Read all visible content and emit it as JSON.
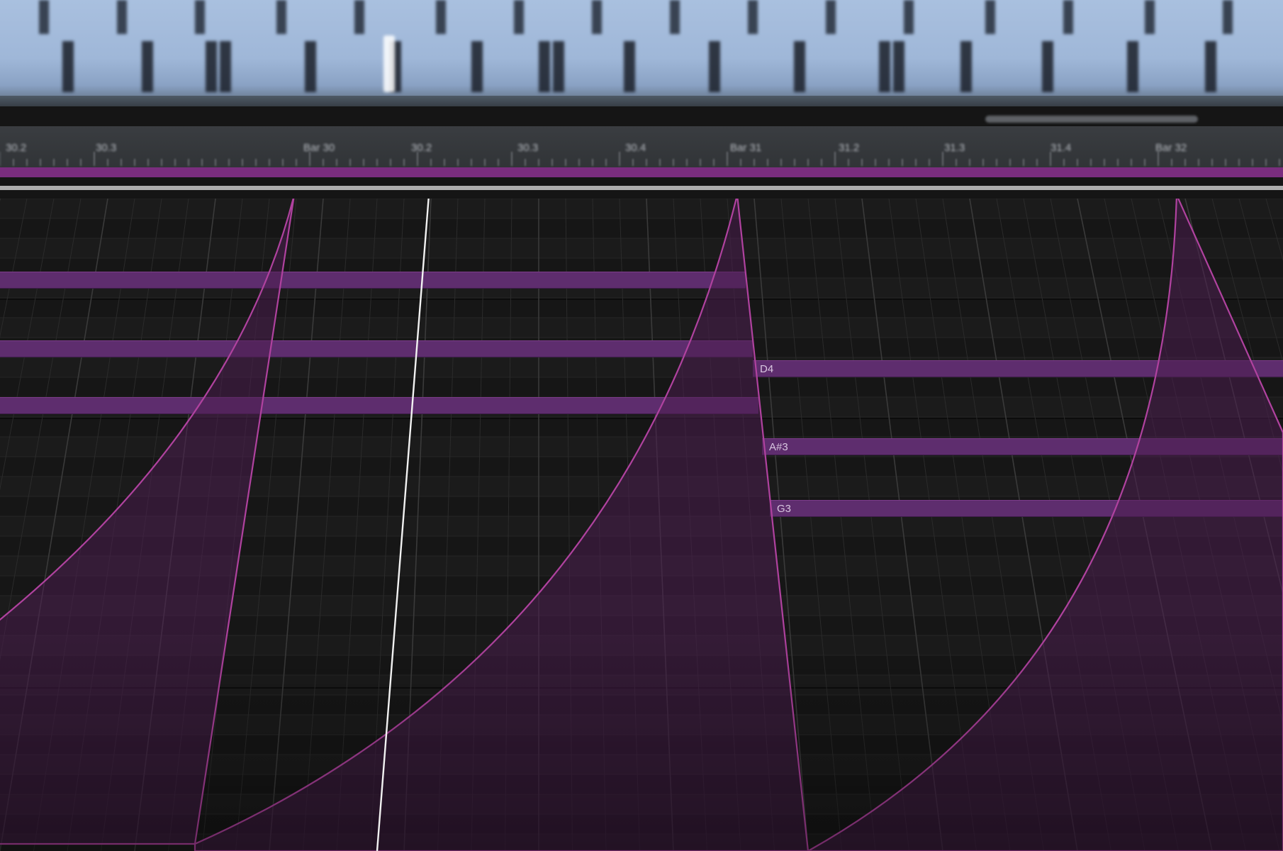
{
  "ruler": {
    "markers": [
      {
        "label": "30.2",
        "bar": false
      },
      {
        "label": "30.3",
        "bar": false
      },
      {
        "label": "Bar 30",
        "bar": true
      },
      {
        "label": "30.2",
        "bar": false
      },
      {
        "label": "30.3",
        "bar": false
      },
      {
        "label": "30.4",
        "bar": false
      },
      {
        "label": "Bar 31",
        "bar": true
      },
      {
        "label": "31.2",
        "bar": false
      },
      {
        "label": "31.3",
        "bar": false
      },
      {
        "label": "31.4",
        "bar": false
      },
      {
        "label": "Bar 32",
        "bar": true
      }
    ]
  },
  "notes": [
    {
      "label": ""
    },
    {
      "label": ""
    },
    {
      "label": ""
    },
    {
      "label": "D4"
    },
    {
      "label": "A#3"
    },
    {
      "label": "G3"
    }
  ],
  "colors": {
    "note": "#5e2d6e",
    "envelope_stroke": "#b0429f",
    "envelope_fill": "#4a1d4e",
    "loop_band": "#7a2d7e",
    "overview_bg": "#a9c0df",
    "playhead": "#ffffff"
  }
}
